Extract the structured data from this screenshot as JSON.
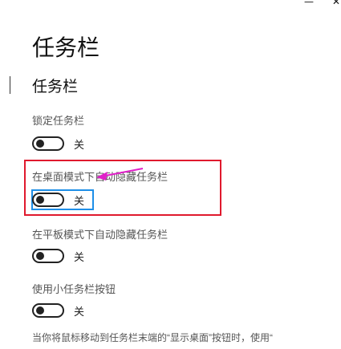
{
  "window": {
    "minimize_glyph": "—",
    "close_glyph": "✕"
  },
  "page": {
    "title": "任务栏",
    "section_title": "任务栏"
  },
  "settings": [
    {
      "label": "锁定任务栏",
      "state": "关",
      "on": false
    },
    {
      "label": "在桌面模式下自动隐藏任务栏",
      "state": "关",
      "on": false
    },
    {
      "label": "在平板模式下自动隐藏任务栏",
      "state": "关",
      "on": false
    },
    {
      "label": "使用小任务栏按钮",
      "state": "关",
      "on": false
    }
  ],
  "footer": {
    "text": "当你将鼠标移动到任务栏末端的“显示桌面”按钮时，使用“"
  },
  "annotation": {
    "box_color": "#e0192d",
    "arrow_color": "#e020c8",
    "focus_color": "#1e8fe8"
  }
}
